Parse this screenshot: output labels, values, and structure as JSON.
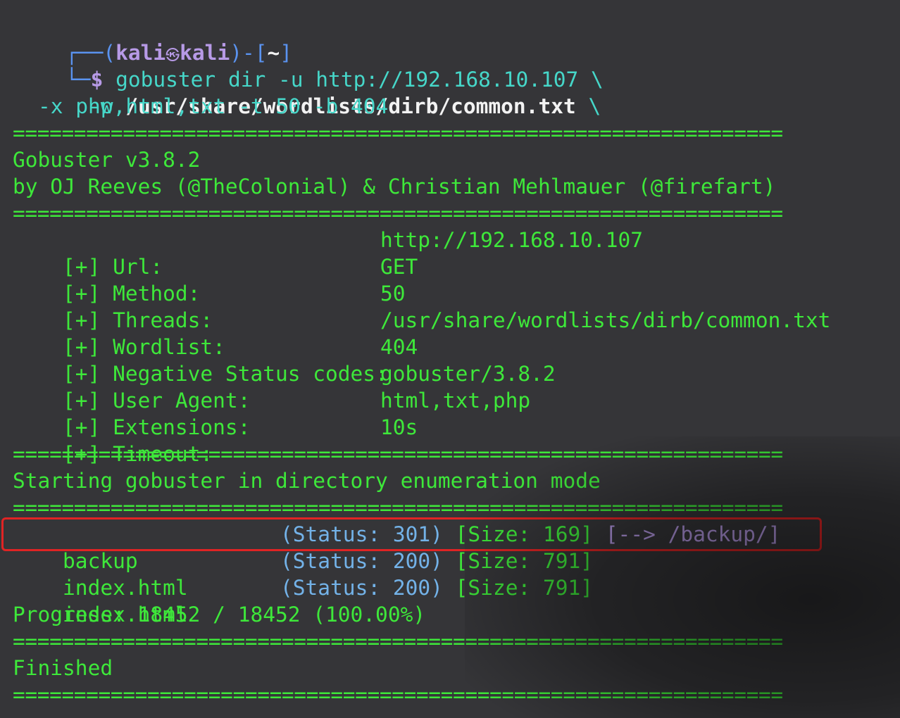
{
  "prompt": {
    "corner_top": "┌──",
    "corner_bottom": "└─",
    "user": "kali",
    "host": "kali",
    "dir": "~",
    "symbol": "$",
    "cmd": "gobuster",
    "args1": "dir -u http://192.168.10.107 \\",
    "flag_w": "-w",
    "wordlist_path": "/usr/share/wordlists/dirb/common.txt",
    "cont": "\\",
    "line3": "-x php,html,txt -t 50 -b 404"
  },
  "divider": "===============================================================",
  "banner": {
    "version": "Gobuster v3.8.2",
    "authors": "by OJ Reeves (@TheColonial) & Christian Mehlmauer (@firefart)"
  },
  "config": [
    {
      "label": "[+] Url:",
      "value": "http://192.168.10.107"
    },
    {
      "label": "[+] Method:",
      "value": "GET"
    },
    {
      "label": "[+] Threads:",
      "value": "50"
    },
    {
      "label": "[+] Wordlist:",
      "value": "/usr/share/wordlists/dirb/common.txt"
    },
    {
      "label": "[+] Negative Status codes:",
      "value": "404"
    },
    {
      "label": "[+] User Agent:",
      "value": "gobuster/3.8.2"
    },
    {
      "label": "[+] Extensions:",
      "value": "html,txt,php"
    },
    {
      "label": "[+] Timeout:",
      "value": "10s"
    }
  ],
  "start_msg": "Starting gobuster in directory enumeration mode",
  "results": [
    {
      "path": "backup",
      "status": "(Status: 301)",
      "size": "[Size: 169]",
      "redirect": "[--> /backup/]"
    },
    {
      "path": "index.html",
      "status": "(Status: 200)",
      "size": "[Size: 791]",
      "redirect": ""
    },
    {
      "path": "index.html",
      "status": "(Status: 200)",
      "size": "[Size: 791]",
      "redirect": ""
    }
  ],
  "progress": "Progress: 18452 / 18452 (100.00%)",
  "finished": "Finished",
  "colors": {
    "background": "#353538",
    "output_green": "#3ee83a",
    "status_blue": "#73b2e8",
    "redirect_purple": "#b79ae6",
    "highlight_red": "#e02424"
  }
}
